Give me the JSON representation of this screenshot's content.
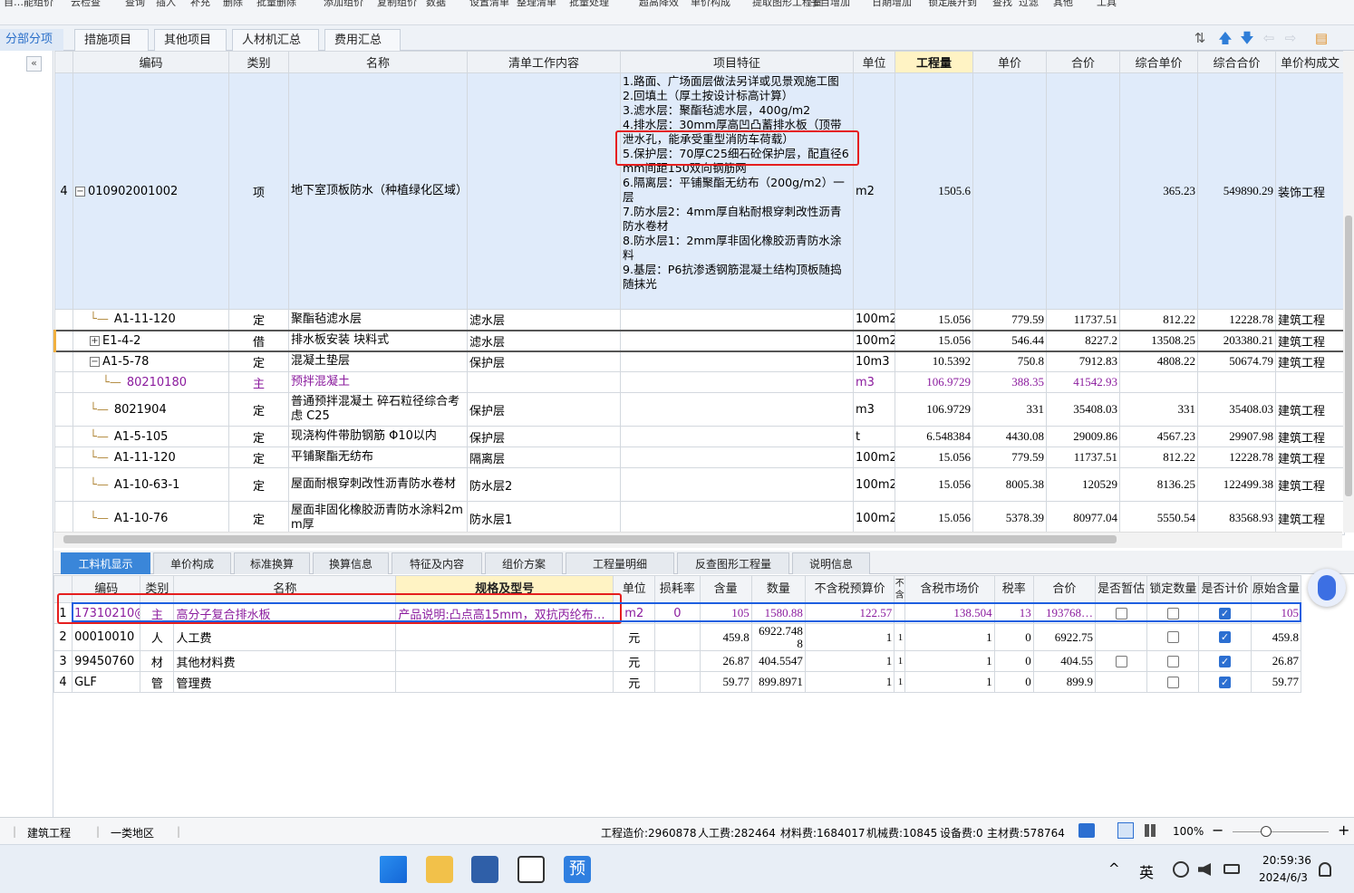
{
  "top_toolbar": [
    "自…能组价",
    "云检查",
    "查询",
    "插入",
    "补充",
    "删除",
    "批量删除",
    "添加组价",
    "复制组价",
    "数据",
    "设置清单",
    "整理清单",
    "批量处理",
    "超高降效",
    "单价构成",
    "提取图形工程量",
    "子目增加",
    "日期增加",
    "锁定",
    "展开到",
    "查找",
    "过滤",
    "其他",
    "工具"
  ],
  "tabs": {
    "t0": "分部分项",
    "t1": "措施项目",
    "t2": "其他项目",
    "t3": "人材机汇总",
    "t4": "费用汇总"
  },
  "toolbar_icons": {
    "i0": "⇅",
    "i1": "🡅",
    "i2": "🡇",
    "i3": "⇦",
    "i4": "⇨",
    "i5": "▤"
  },
  "upper": {
    "headers": {
      "h1": "编码",
      "h2": "类别",
      "h3": "名称",
      "h4": "清单工作内容",
      "h5": "项目特征",
      "h6": "单位",
      "h7": "工程量",
      "h8": "单价",
      "h9": "合价",
      "h10": "综合单价",
      "h11": "综合合价",
      "h12": "单价构成文"
    },
    "main": {
      "no": "4",
      "code": "010902001002",
      "type": "项",
      "name": "地下室顶板防水（种植绿化区域）",
      "feature": "1.路面、广场面层做法另详或见景观施工图\n2.回填土（厚土按设计标高计算）\n3.滤水层：聚酯毡滤水层，400g/m2\n4.排水层：30mm厚高凹凸蓄排水板（顶带泄水孔，能承受重型消防车荷载）\n5.保护层：70厚C25细石砼保护层，配直径6mm间距150双向钢筋网\n6.隔离层：平铺聚酯无纺布（200g/m2）一层\n7.防水层2：4mm厚自粘耐根穿刺改性沥青防水卷材\n8.防水层1：2mm厚非固化橡胶沥青防水涂料\n9.基层：P6抗渗透钢筋混凝土结构顶板随捣随抹光",
      "unit": "m2",
      "qty": "1505.6",
      "uprice": "",
      "total": "",
      "cuprice": "365.23",
      "ctotal": "549890.29",
      "comp": "装饰工程"
    },
    "rows": [
      {
        "code": "A1-11-120",
        "type": "定",
        "name": "聚酯毡滤水层",
        "work": "滤水层",
        "unit": "100m2",
        "qty": "15.056",
        "uprice": "779.59",
        "total": "11737.51",
        "cuprice": "812.22",
        "ctotal": "12228.78",
        "comp": "建筑工程"
      },
      {
        "code": "E1-4-2",
        "type": "借",
        "name": "排水板安装 块料式",
        "work": "滤水层",
        "unit": "100m2",
        "qty": "15.056",
        "uprice": "546.44",
        "total": "8227.2",
        "cuprice": "13508.25",
        "ctotal": "203380.21",
        "comp": "建筑工程"
      },
      {
        "code": "A1-5-78",
        "type": "定",
        "name": "混凝土垫层",
        "work": "保护层",
        "unit": "10m3",
        "qty": "10.5392",
        "uprice": "750.8",
        "total": "7912.83",
        "cuprice": "4808.22",
        "ctotal": "50674.79",
        "comp": "建筑工程"
      },
      {
        "code": "80210180",
        "type": "主",
        "name": "预拌混凝土",
        "work": "",
        "unit": "m3",
        "qty": "106.9729",
        "uprice": "388.35",
        "total": "41542.93",
        "cuprice": "",
        "ctotal": "",
        "comp": ""
      },
      {
        "code": "8021904",
        "type": "定",
        "name": "普通预拌混凝土 碎石粒径综合考虑 C25",
        "work": "保护层",
        "unit": "m3",
        "qty": "106.9729",
        "uprice": "331",
        "total": "35408.03",
        "cuprice": "331",
        "ctotal": "35408.03",
        "comp": "建筑工程"
      },
      {
        "code": "A1-5-105",
        "type": "定",
        "name": "现浇构件带肋钢筋 Φ10以内",
        "work": "保护层",
        "unit": "t",
        "qty": "6.548384",
        "uprice": "4430.08",
        "total": "29009.86",
        "cuprice": "4567.23",
        "ctotal": "29907.98",
        "comp": "建筑工程"
      },
      {
        "code": "A1-11-120",
        "type": "定",
        "name": "平铺聚酯无纺布",
        "work": "隔离层",
        "unit": "100m2",
        "qty": "15.056",
        "uprice": "779.59",
        "total": "11737.51",
        "cuprice": "812.22",
        "ctotal": "12228.78",
        "comp": "建筑工程"
      },
      {
        "code": "A1-10-63-1",
        "type": "定",
        "name": "屋面耐根穿刺改性沥青防水卷材",
        "work": "防水层2",
        "unit": "100m2",
        "qty": "15.056",
        "uprice": "8005.38",
        "total": "120529",
        "cuprice": "8136.25",
        "ctotal": "122499.38",
        "comp": "建筑工程"
      },
      {
        "code": "A1-10-76",
        "type": "定",
        "name": "屋面非固化橡胶沥青防水涂料2mm厚",
        "work": "防水层1",
        "unit": "100m2",
        "qty": "15.056",
        "uprice": "5378.39",
        "total": "80977.04",
        "cuprice": "5550.54",
        "ctotal": "83568.93",
        "comp": "建筑工程"
      }
    ]
  },
  "bottom_tabs": {
    "b0": "工料机显示",
    "b1": "单价构成",
    "b2": "标准换算",
    "b3": "换算信息",
    "b4": "特征及内容",
    "b5": "组价方案",
    "b6": "工程量明细",
    "b7": "反查图形工程量",
    "b8": "说明信息"
  },
  "lower": {
    "headers": {
      "l0": "编码",
      "l1": "类别",
      "l2": "名称",
      "l3": "规格及型号",
      "l4": "单位",
      "l5": "损耗率",
      "l6": "含量",
      "l7": "数量",
      "l8": "不含税预算价",
      "l9": "不含",
      "l10": "含税市场价",
      "l11": "税率",
      "l12": "合价",
      "l13": "是否暂估",
      "l14": "锁定数量",
      "l15": "是否计价",
      "l16": "原始含量"
    },
    "rows": [
      {
        "no": "1",
        "code": "17310210@5",
        "type": "主",
        "name": "高分子复合排水板",
        "spec": "产品说明:凸点高15mm，双抗丙纶布…",
        "unit": "m2",
        "loss": "0",
        "content": "105",
        "count": "1580.88",
        "ntprice": "122.57",
        "nt": "",
        "tprice": "138.504",
        "tax": "13",
        "total": "193768…",
        "zg": false,
        "lock": false,
        "calc": true,
        "orig": "105"
      },
      {
        "no": "2",
        "code": "00010010",
        "type": "人",
        "name": "人工费",
        "spec": "",
        "unit": "元",
        "loss": "",
        "content": "459.8",
        "count": "6922.748\n8",
        "ntprice": "1",
        "nt": "1",
        "tprice": "1",
        "tax": "0",
        "total": "6922.75",
        "zg": null,
        "lock": false,
        "calc": true,
        "orig": "459.8"
      },
      {
        "no": "3",
        "code": "99450760",
        "type": "材",
        "name": "其他材料费",
        "spec": "",
        "unit": "元",
        "loss": "",
        "content": "26.87",
        "count": "404.5547",
        "ntprice": "1",
        "nt": "1",
        "tprice": "1",
        "tax": "0",
        "total": "404.55",
        "zg": false,
        "lock": false,
        "calc": true,
        "orig": "26.87"
      },
      {
        "no": "4",
        "code": "GLF",
        "type": "管",
        "name": "管理费",
        "spec": "",
        "unit": "元",
        "loss": "",
        "content": "59.77",
        "count": "899.8971",
        "ntprice": "1",
        "nt": "1",
        "tprice": "1",
        "tax": "0",
        "total": "899.9",
        "zg": null,
        "lock": false,
        "calc": true,
        "orig": "59.77"
      }
    ]
  },
  "status": {
    "s0": "建筑工程",
    "s1": "一类地区",
    "s2": "工程造价:2960878",
    "s3": "人工费:282464",
    "s4": "材料费:1684017",
    "s5": "机械费:10845",
    "s6": "设备费:0",
    "s7": "主材费:578764",
    "zoom": "100%"
  },
  "taskbar": {
    "caret": "^",
    "ime": "英",
    "time": "20:59:36",
    "date": "2024/6/3"
  }
}
